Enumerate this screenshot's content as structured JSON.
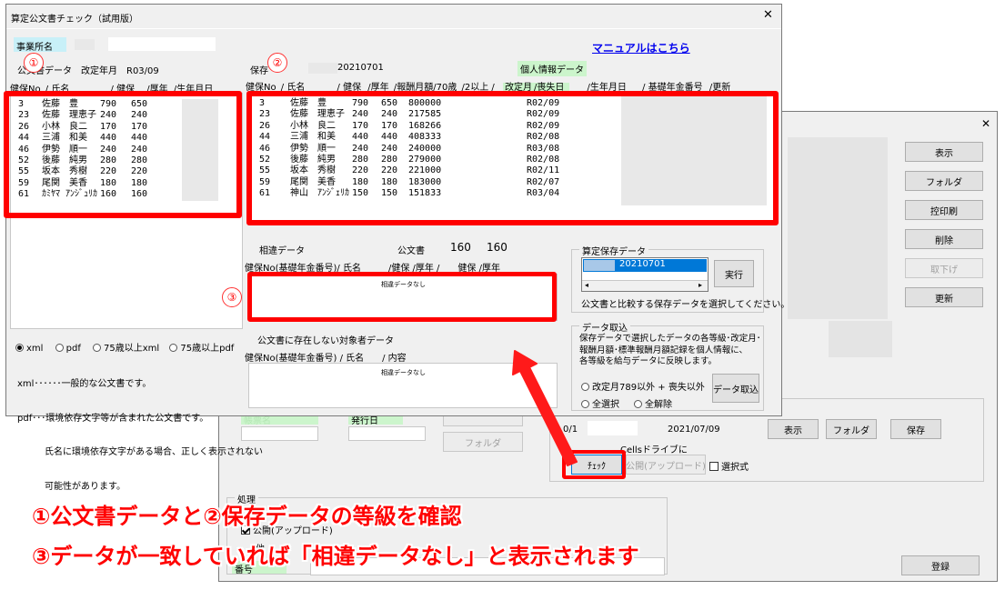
{
  "back_window": {
    "close_glyph": "✕",
    "buttons": {
      "show": "表示",
      "folder": "フォルダ",
      "print": "控印刷",
      "delete": "削除",
      "withdraw": "取下げ",
      "update": "更新",
      "register": "登録"
    },
    "lower": {
      "count_text": "0/1",
      "date_text": "2021/07/09",
      "show_button": "表示",
      "folder_button": "フォルダ",
      "save_button": "保存",
      "cells_label": "Cellsドライブに",
      "check_button": "ﾁｪｯｸ",
      "publish_button": "公開(アップロード)",
      "select_label": "選択式",
      "mid_folder_button": "フォルダ",
      "issue_label": "発行日",
      "left_green_label": "帳票名",
      "process_group": "処理",
      "process_item": "公開(アップロード)",
      "process_item2": "他",
      "num_label": "番号"
    }
  },
  "front_window": {
    "title": "算定公文書チェック（試用版）",
    "close_glyph": "✕",
    "office_label": "事業所名",
    "manual_link": "マニュアルはこちら",
    "left_header_text": "公文書データ　改定年月　R03/09",
    "left_cols": [
      "健保No",
      "/ 氏名",
      "/ 健保",
      "/厚年",
      "/生年月日"
    ],
    "left_rows": [
      {
        "no": "3",
        "name": "佐藤　豊",
        "kenpo": "790",
        "kounen": "650"
      },
      {
        "no": "23",
        "name": "佐藤　理恵子",
        "kenpo": "240",
        "kounen": "240"
      },
      {
        "no": "26",
        "name": "小林　良二",
        "kenpo": "170",
        "kounen": "170"
      },
      {
        "no": "44",
        "name": "三浦　和美",
        "kenpo": "440",
        "kounen": "440"
      },
      {
        "no": "46",
        "name": "伊勢　順一",
        "kenpo": "240",
        "kounen": "240"
      },
      {
        "no": "52",
        "name": "後藤　純男",
        "kenpo": "280",
        "kounen": "280"
      },
      {
        "no": "55",
        "name": "坂本　秀樹",
        "kenpo": "220",
        "kounen": "220"
      },
      {
        "no": "59",
        "name": "尾関　美香",
        "kenpo": "180",
        "kounen": "180"
      },
      {
        "no": "61",
        "name": "ｶﾐﾔﾏ ｱﾝｼﾞｭﾘｶ",
        "kenpo": "160",
        "kounen": "160"
      }
    ],
    "save_label": "保存",
    "save_date": "20210701",
    "personal_label": "個人情報データ",
    "right_cols": [
      "健保No",
      "/ 氏名",
      "/ 健保",
      "/厚年",
      "/報酬月額/70歳",
      "/2以上 /",
      "改定月",
      "/喪失日",
      "/生年月日",
      "/ 基礎年金番号",
      "/更新"
    ],
    "right_rows": [
      {
        "no": "3",
        "name": "佐藤　豊",
        "kenpo": "790",
        "kounen": "650",
        "amount": "800000",
        "month": "R02/09"
      },
      {
        "no": "23",
        "name": "佐藤　理恵子",
        "kenpo": "240",
        "kounen": "240",
        "amount": "217585",
        "month": "R02/09"
      },
      {
        "no": "26",
        "name": "小林　良二",
        "kenpo": "170",
        "kounen": "170",
        "amount": "168266",
        "month": "R02/09"
      },
      {
        "no": "44",
        "name": "三浦　和美",
        "kenpo": "440",
        "kounen": "440",
        "amount": "408333",
        "month": "R02/08"
      },
      {
        "no": "46",
        "name": "伊勢　順一",
        "kenpo": "240",
        "kounen": "240",
        "amount": "240000",
        "month": "R03/08"
      },
      {
        "no": "52",
        "name": "後藤　純男",
        "kenpo": "280",
        "kounen": "280",
        "amount": "279000",
        "month": "R02/08"
      },
      {
        "no": "55",
        "name": "坂本　秀樹",
        "kenpo": "220",
        "kounen": "220",
        "amount": "221000",
        "month": "R02/11"
      },
      {
        "no": "59",
        "name": "尾関　美香",
        "kenpo": "180",
        "kounen": "180",
        "amount": "183000",
        "month": "R02/07"
      },
      {
        "no": "61",
        "name": "神山　ｱﾝｼﾞｪﾘｶ",
        "kenpo": "150",
        "kounen": "150",
        "amount": "151833",
        "month": "R03/04"
      }
    ],
    "diff_label": "相違データ",
    "kobunsho_label": "公文書",
    "kobunsho_val1": "160",
    "kobunsho_val2": "160",
    "diff_cols": "健保No(基礎年金番号)/ 氏名　　　/健保 /厚年 /　　健保 /厚年",
    "diff_none": "相違データなし",
    "notexist_label": "公文書に存在しない対象者データ",
    "notexist_cols": "健保No(基礎年金番号) / 氏名　　/ 内容",
    "notexist_none": "相違データなし",
    "format_options": [
      "xml",
      "pdf",
      "75歳以上xml",
      "75歳以上pdf"
    ],
    "format_notes": [
      "xml･･････一般的な公文書です。",
      "pdf･･･環境依存文字等が含まれた公文書です。",
      "　　　氏名に環境依存文字がある場合、正しく表示されない",
      "　　　可能性があります。"
    ],
    "saved_group": {
      "title": "算定保存データ",
      "selected_item": "20210701",
      "run_button": "実行",
      "note": "公文書と比較する保存データを選択してください。"
    },
    "import_group": {
      "title": "データ取込",
      "desc": [
        "保存データで選択したデータの各等級･改定月･",
        "報酬月額･標準報酬月額記録を個人情報に、",
        "各等級を給与データに反映します。"
      ],
      "radio1": "改定月789以外 + 喪失以外",
      "radio2": "全選択",
      "radio3": "全解除",
      "button": "データ取込"
    }
  },
  "annotations": {
    "marker1": "①",
    "marker2": "②",
    "marker3": "③",
    "caption1": "①公文書データと②保存データの等級を確認",
    "caption2": "③データが一致していれば「相違データなし」と表示されます"
  },
  "colors": {
    "accent_red": "#ff0000",
    "label_green": "#ccf5cc",
    "label_cyan": "#c8f0f8",
    "selection_blue": "#0078d7"
  }
}
